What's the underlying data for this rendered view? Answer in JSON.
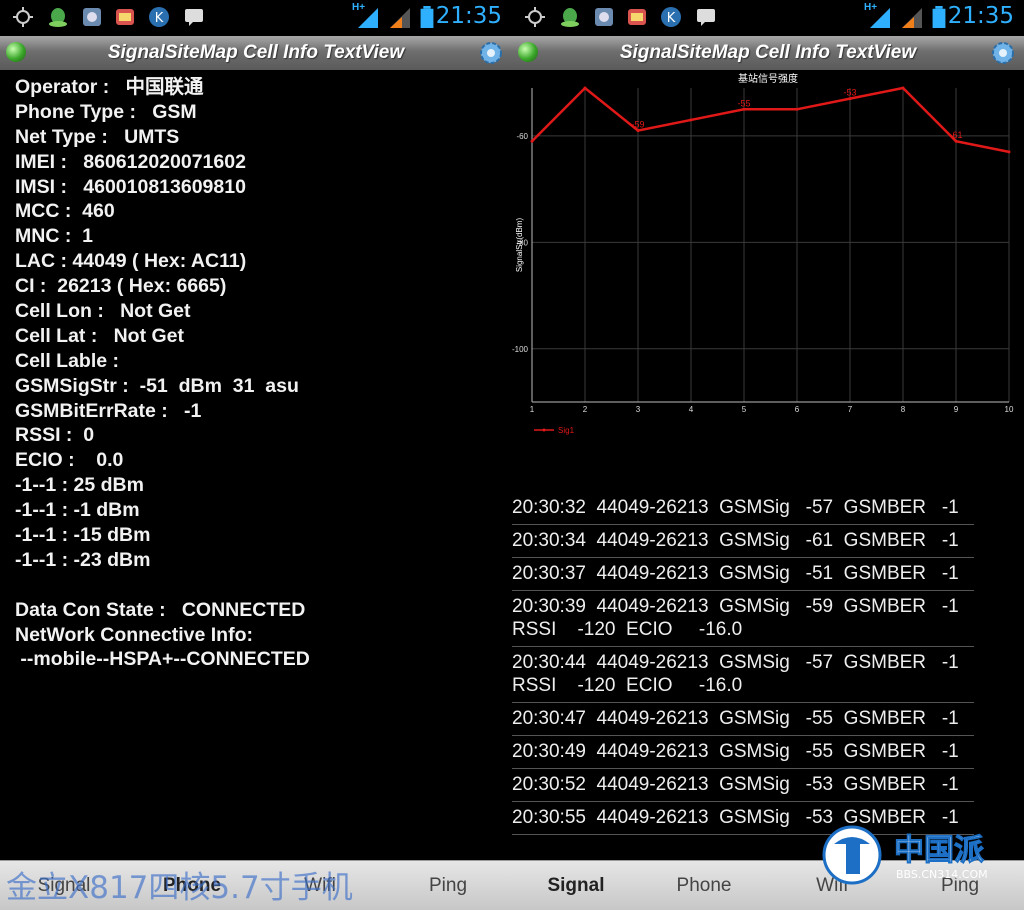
{
  "status_bar": {
    "time": "21:35",
    "network_label": "H+"
  },
  "app": {
    "title": "SignalSiteMap Cell Info TextView",
    "accent_color": "#2fb0ff"
  },
  "info_rows": [
    "Operator :   中国联通",
    "Phone Type :   GSM",
    "Net Type :   UMTS",
    "IMEI :   860612020071602",
    "IMSI :   460010813609810",
    "MCC :  460",
    "MNC :  1",
    "LAC : 44049 ( Hex: AC11)",
    "CI :  26213 ( Hex: 6665)",
    "Cell Lon :   Not Get",
    "Cell Lat :   Not Get",
    "Cell Lable :",
    "GSMSigStr :  -51  dBm  31  asu",
    "GSMBitErrRate :   -1",
    "RSSI :  0",
    "ECIO :    0.0",
    "-1--1 : 25 dBm",
    "-1--1 : -1 dBm",
    "-1--1 : -15 dBm",
    "-1--1 : -23 dBm",
    "",
    "Data Con State :   CONNECTED",
    "NetWork Connective Info:",
    " --mobile--HSPA+--CONNECTED"
  ],
  "chart_data": {
    "type": "line",
    "title": "基站信号强度",
    "ylabel": "SignalStr(dBm)",
    "xlabel": "",
    "x": [
      1,
      2,
      3,
      4,
      5,
      6,
      7,
      8,
      9,
      10
    ],
    "xlim": [
      1,
      10
    ],
    "ylim": [
      -110,
      -51
    ],
    "y_ticks": [
      -60,
      -80,
      -100
    ],
    "x_ticks": [
      1,
      2,
      3,
      4,
      5,
      6,
      7,
      8,
      9,
      10
    ],
    "grid": true,
    "legend_position": "bottom-left",
    "series": [
      {
        "name": "Sig1",
        "color": "#e01818",
        "values": [
          -61,
          -51,
          -59,
          -57,
          -55,
          -55,
          -53,
          -51,
          -61,
          -63
        ],
        "labels": [
          "",
          "",
          "-59",
          "",
          "-55",
          "",
          "-53",
          "",
          "-61",
          ""
        ]
      }
    ]
  },
  "log_entries": [
    {
      "line1": "20:30:32  44049-26213  GSMSig   -57  GSMBER   -1",
      "line2": ""
    },
    {
      "line1": "20:30:34  44049-26213  GSMSig   -61  GSMBER   -1",
      "line2": ""
    },
    {
      "line1": "20:30:37  44049-26213  GSMSig   -51  GSMBER   -1",
      "line2": ""
    },
    {
      "line1": "20:30:39  44049-26213  GSMSig   -59  GSMBER   -1",
      "line2": "RSSI    -120  ECIO     -16.0"
    },
    {
      "line1": "20:30:44  44049-26213  GSMSig   -57  GSMBER   -1",
      "line2": "RSSI    -120  ECIO     -16.0"
    },
    {
      "line1": "20:30:47  44049-26213  GSMSig   -55  GSMBER   -1",
      "line2": ""
    },
    {
      "line1": "20:30:49  44049-26213  GSMSig   -55  GSMBER   -1",
      "line2": ""
    },
    {
      "line1": "20:30:52  44049-26213  GSMSig   -53  GSMBER   -1",
      "line2": ""
    },
    {
      "line1": "20:30:55  44049-26213  GSMSig   -53  GSMBER   -1",
      "line2": ""
    }
  ],
  "tabs": [
    "Signal",
    "Phone",
    "Wifi",
    "Ping"
  ],
  "watermark": "金立X817四核5.7寸手机",
  "logo": {
    "text": "中国派",
    "url_text": "BBS.CN314.COM"
  }
}
